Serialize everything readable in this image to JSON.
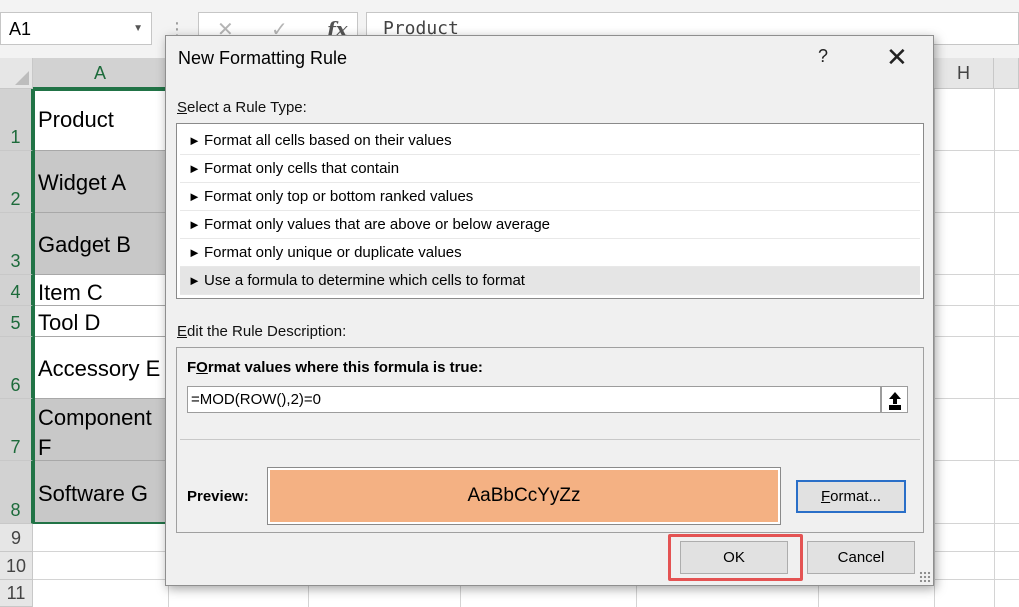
{
  "formula_bar": {
    "name_box": "A1",
    "separator": "⋮",
    "cancel_icon": "✕",
    "enter_icon": "✓",
    "function_icon": "fx",
    "content": "Product"
  },
  "grid": {
    "columns": [
      "A",
      "H"
    ],
    "row_numbers": [
      "1",
      "2",
      "3",
      "4",
      "5",
      "6",
      "7",
      "8",
      "9",
      "10",
      "11"
    ],
    "cells": [
      "Product",
      "Widget A",
      "Gadget B",
      "Item C",
      "Tool D",
      "Accessory E",
      "Component F",
      "Software G"
    ],
    "shading_color": "#c8c8c8",
    "selection_color": "#217346"
  },
  "dialog": {
    "title": "New Formatting Rule",
    "help_label": "?",
    "close_label": "✕",
    "rule_type_label_underlined": "S",
    "rule_type_label_rest": "elect a Rule Type:",
    "rule_arrow": "►",
    "rules": [
      "Format all cells based on their values",
      "Format only cells that contain",
      "Format only top or bottom ranked values",
      "Format only values that are above or below average",
      "Format only unique or duplicate values",
      "Use a formula to determine which cells to format"
    ],
    "selected_rule_index": 5,
    "edit_label_underlined": "E",
    "edit_label_rest": "dit the Rule Description:",
    "formula_label_underlined": "O",
    "formula_label_prefix": "F",
    "formula_label_rest": "rmat values where this formula is true:",
    "formula": "=MOD(ROW(),2)=0",
    "preview_label": "Preview:",
    "preview_text": "AaBbCcYyZz",
    "preview_color": "#f4b183",
    "format_button_underlined": "F",
    "format_button_rest": "ormat...",
    "ok_label": "OK",
    "cancel_label": "Cancel",
    "highlight_color": "#e45353"
  }
}
